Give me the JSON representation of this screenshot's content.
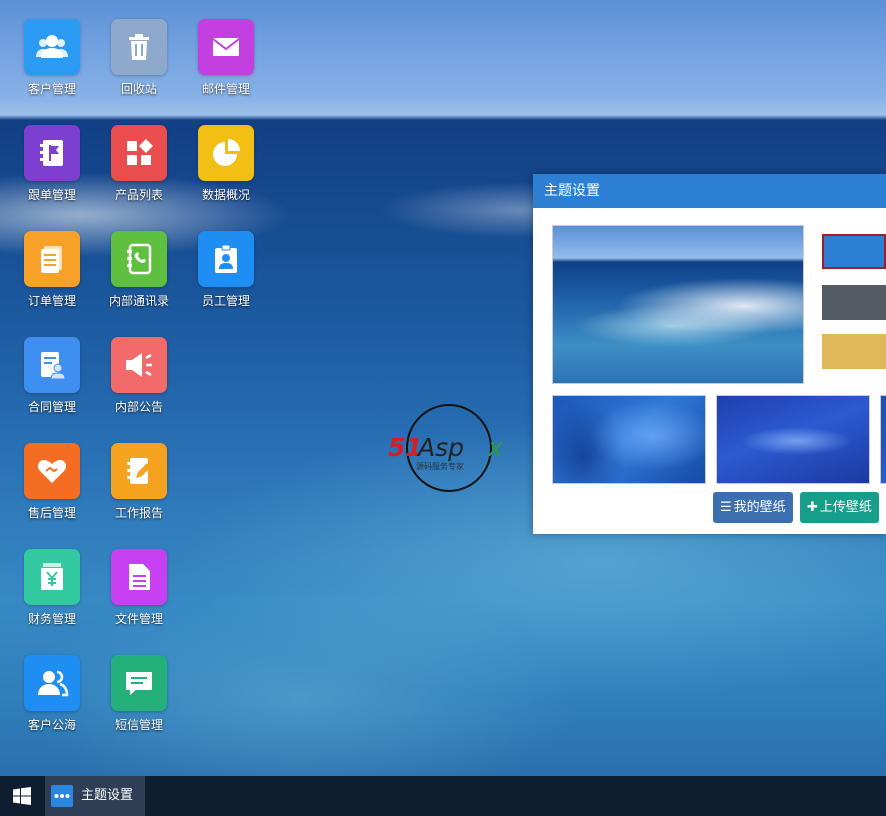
{
  "desktop_icons": [
    {
      "label": "客户管理",
      "icon": "users-icon",
      "color": "#2a9af3"
    },
    {
      "label": "回收站",
      "icon": "trash-icon",
      "color": "#8fa9cc"
    },
    {
      "label": "邮件管理",
      "icon": "mail-icon",
      "color": "#c43fe0"
    },
    {
      "label": "跟单管理",
      "icon": "notebook-flag-icon",
      "color": "#7d3fcf"
    },
    {
      "label": "产品列表",
      "icon": "product-grid-icon",
      "color": "#ea4d4d"
    },
    {
      "label": "数据概况",
      "icon": "pie-chart-icon",
      "color": "#f2c015"
    },
    {
      "label": "订单管理",
      "icon": "document-list-icon",
      "color": "#f7a128"
    },
    {
      "label": "内部通讯录",
      "icon": "phone-book-icon",
      "color": "#5fbf3f"
    },
    {
      "label": "员工管理",
      "icon": "id-badge-icon",
      "color": "#1f8ef2"
    },
    {
      "label": "合同管理",
      "icon": "contract-icon",
      "color": "#3f8ff0"
    },
    {
      "label": "内部公告",
      "icon": "megaphone-icon",
      "color": "#f36a6a"
    },
    {
      "label": "售后管理",
      "icon": "handshake-heart-icon",
      "color": "#f46d22"
    },
    {
      "label": "工作报告",
      "icon": "report-pen-icon",
      "color": "#f5a21f"
    },
    {
      "label": "财务管理",
      "icon": "finance-yen-icon",
      "color": "#33c9a0"
    },
    {
      "label": "文件管理",
      "icon": "file-icon",
      "color": "#c63ff0"
    },
    {
      "label": "客户公海",
      "icon": "user-group-icon",
      "color": "#1f8ef2"
    },
    {
      "label": "短信管理",
      "icon": "message-icon",
      "color": "#23b07a"
    }
  ],
  "logo": {
    "main": "51Aspx",
    "sub": "源码服务专家"
  },
  "theme_window": {
    "title": "主题设置",
    "swatches": [
      {
        "color": "#2c7fd3",
        "selected": true
      },
      {
        "color": "#555b63",
        "selected": false
      },
      {
        "color": "#e0b85a",
        "selected": false
      }
    ],
    "buttons": {
      "my_wallpaper": "我的壁纸",
      "upload_wallpaper": "上传壁纸"
    },
    "accent": "#2c7fd3"
  },
  "taskbar": {
    "start_icon": "windows-icon",
    "task_label": "主题设置",
    "task_icon": "dots-icon"
  }
}
